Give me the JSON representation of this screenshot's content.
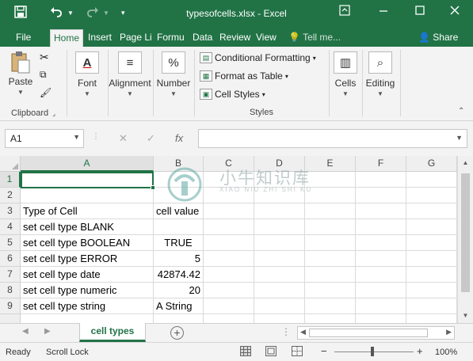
{
  "window": {
    "title": "typesofcells.xlsx - Excel",
    "save_icon": "save-icon",
    "undo_icon": "undo-icon",
    "redo_icon": "redo-icon",
    "restore_icon": "restore-window-icon",
    "minimize_icon": "minimize-icon",
    "maximize_icon": "maximize-icon",
    "close_icon": "close-icon"
  },
  "tabs": [
    {
      "label": "File"
    },
    {
      "label": "Home"
    },
    {
      "label": "Insert"
    },
    {
      "label": "Page Li"
    },
    {
      "label": "Formu"
    },
    {
      "label": "Data"
    },
    {
      "label": "Review"
    },
    {
      "label": "View"
    },
    {
      "label": "Tell me..."
    }
  ],
  "share_label": "Share",
  "ribbon": {
    "clipboard": {
      "paste": "Paste",
      "group_label": "Clipboard"
    },
    "font": {
      "label": "Font"
    },
    "alignment": {
      "label": "Alignment"
    },
    "number": {
      "label": "Number"
    },
    "styles": {
      "conditional_formatting": "Conditional Formatting",
      "format_as_table": "Format as Table",
      "cell_styles": "Cell Styles",
      "group_label": "Styles"
    },
    "cells": {
      "label": "Cells"
    },
    "editing": {
      "label": "Editing"
    }
  },
  "formula_bar": {
    "name_box": "A1",
    "fx": "fx",
    "cancel": "✕",
    "enter": "✓",
    "value": ""
  },
  "columns": [
    "A",
    "B",
    "C",
    "D",
    "E",
    "F",
    "G"
  ],
  "rows": [
    {
      "num": "1",
      "a": "",
      "b": ""
    },
    {
      "num": "2",
      "a": "",
      "b": ""
    },
    {
      "num": "3",
      "a": "Type of Cell",
      "b": "cell value"
    },
    {
      "num": "4",
      "a": "set cell type BLANK",
      "b": ""
    },
    {
      "num": "5",
      "a": "set cell type BOOLEAN",
      "b": "TRUE"
    },
    {
      "num": "6",
      "a": "set cell type ERROR",
      "b": "5"
    },
    {
      "num": "7",
      "a": "set cell type date",
      "b": "42874.42"
    },
    {
      "num": "8",
      "a": "set cell type numeric",
      "b": "20"
    },
    {
      "num": "9",
      "a": "set cell type string",
      "b": "A String"
    }
  ],
  "watermark": {
    "text": "小牛知识库",
    "sub": "XIAO NIU ZHI SHI KU"
  },
  "sheet_tab": "cell types",
  "status": {
    "ready": "Ready",
    "scroll_lock": "Scroll Lock",
    "zoom": "100%"
  }
}
